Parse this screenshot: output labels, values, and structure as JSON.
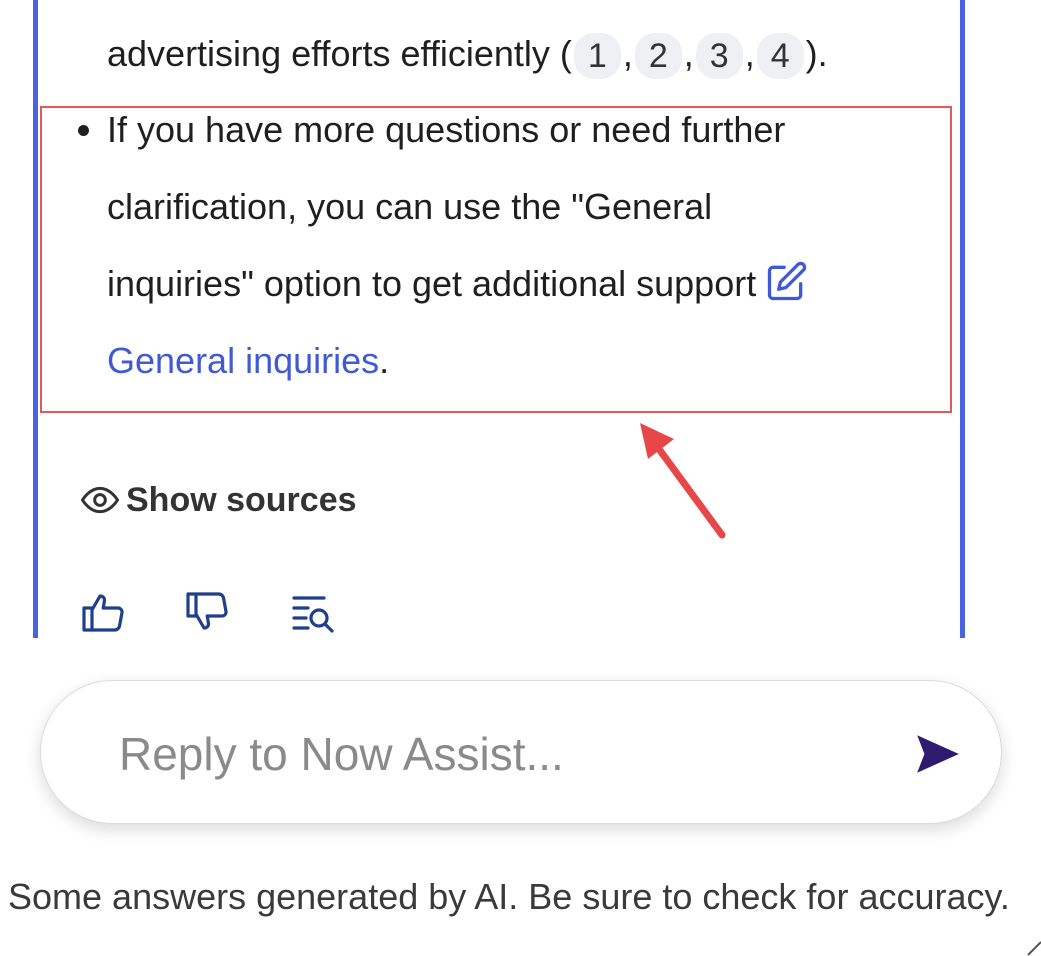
{
  "message": {
    "line1_text": "advertising efforts efficiently (",
    "citations": [
      "1",
      "2",
      "3",
      "4"
    ],
    "line1_end": ").",
    "bullet_line1": "If you have more questions or need further",
    "bullet_line2": "clarification, you can use the \"General",
    "bullet_line3": "inquiries\" option to get additional support",
    "link_text": "General inquiries",
    "link_end": "."
  },
  "actions": {
    "show_sources_label": "Show sources"
  },
  "reply": {
    "placeholder": "Reply to Now Assist..."
  },
  "footer": {
    "disclaimer": "Some answers generated by AI. Be sure to check for accuracy."
  },
  "colors": {
    "accent_blue": "#4a63e0",
    "link_blue": "#4059d6",
    "highlight_red": "#e05a5a",
    "send_purple": "#2e1a6e"
  }
}
